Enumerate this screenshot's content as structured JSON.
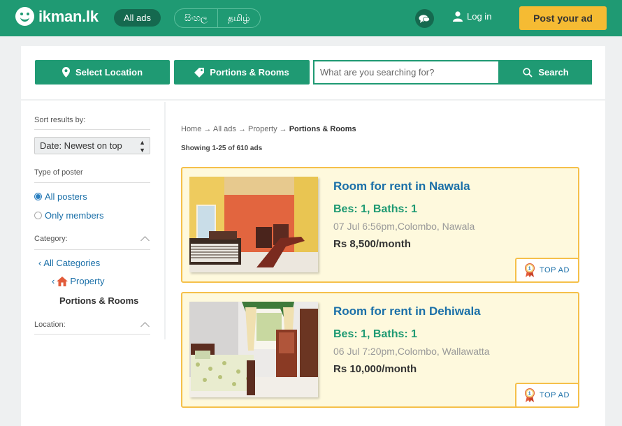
{
  "header": {
    "logo_text": "ikman.lk",
    "all_ads": "All ads",
    "languages": [
      "සිංහල",
      "தமிழ்"
    ],
    "login": "Log in",
    "post_ad": "Post your ad"
  },
  "search": {
    "location_button": "Select Location",
    "category_button": "Portions & Rooms",
    "placeholder": "What are you searching for?",
    "search_button": "Search"
  },
  "sidebar": {
    "sort_label": "Sort results by:",
    "sort_value": "Date: Newest on top",
    "poster_label": "Type of poster",
    "poster_options": [
      "All posters",
      "Only members"
    ],
    "category_label": "Category:",
    "all_categories": "All Categories",
    "property": "Property",
    "current_category": "Portions & Rooms",
    "location_label": "Location:"
  },
  "breadcrumb": {
    "items": [
      "Home",
      "All ads",
      "Property"
    ],
    "current": "Portions & Rooms",
    "separator": "→"
  },
  "results_count": "Showing 1-25 of 610 ads",
  "ads": [
    {
      "title": "Room for rent in Nawala",
      "specs": "Bes: 1, Baths: 1",
      "meta": "07 Jul 6:56pm,Colombo, Nawala",
      "price": "Rs 8,500/month",
      "badge": "TOP AD"
    },
    {
      "title": "Room for rent in Dehiwala",
      "specs": "Bes: 1, Baths: 1",
      "meta": "06 Jul 7:20pm,Colombo, Wallawatta",
      "price": "Rs 10,000/month",
      "badge": "TOP AD"
    }
  ],
  "colors": {
    "brand_green": "#1f9a73",
    "accent_yellow": "#f5bb33",
    "link_blue": "#1a6fa8",
    "ad_background": "#fef9dd"
  }
}
